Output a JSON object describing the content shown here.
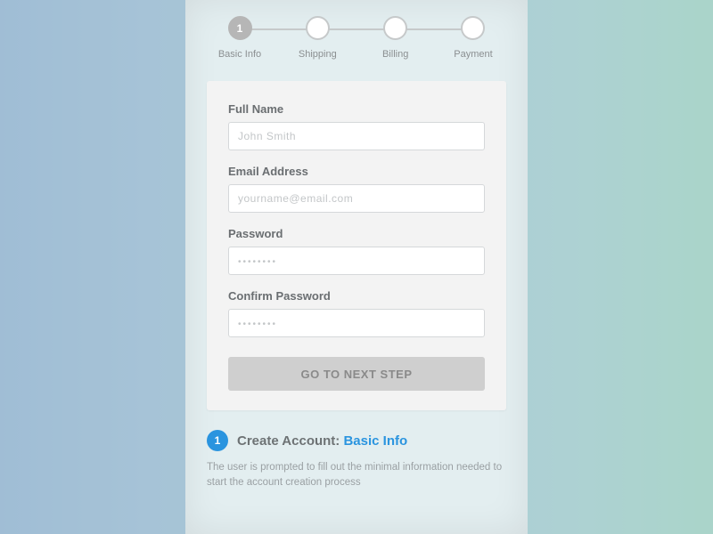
{
  "stepper": {
    "steps": [
      {
        "num": "1",
        "label": "Basic Info",
        "active": true
      },
      {
        "num": "",
        "label": "Shipping",
        "active": false
      },
      {
        "num": "",
        "label": "Billing",
        "active": false
      },
      {
        "num": "",
        "label": "Payment",
        "active": false
      }
    ]
  },
  "form": {
    "fullname_label": "Full Name",
    "fullname_placeholder": "John Smith",
    "email_label": "Email Address",
    "email_placeholder": "yourname@email.com",
    "password_label": "Password",
    "password_placeholder": "••••••••",
    "confirm_label": "Confirm Password",
    "confirm_placeholder": "••••••••",
    "submit_label": "GO TO NEXT STEP"
  },
  "caption": {
    "badge": "1",
    "title_prefix": "Create Account: ",
    "title_accent": "Basic Info",
    "body": "The user is prompted to fill out the minimal information needed to start the account creation process"
  }
}
